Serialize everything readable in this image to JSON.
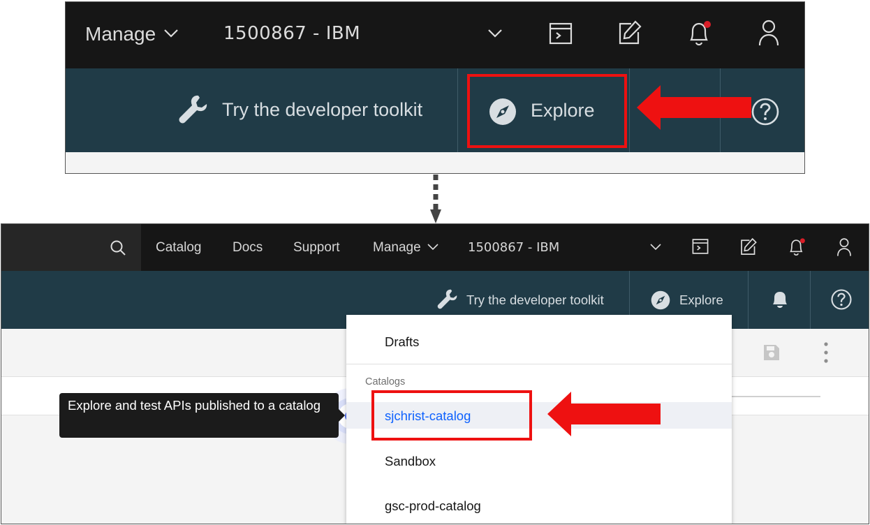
{
  "top_screenshot": {
    "header": {
      "manage_label": "Manage",
      "org_label": "1500867 - IBM"
    },
    "subheader": {
      "toolkit_label": "Try the developer toolkit",
      "explore_label": "Explore"
    }
  },
  "bottom_screenshot": {
    "header": {
      "nav_items": [
        "Catalog",
        "Docs",
        "Support"
      ],
      "manage_label": "Manage",
      "org_label": "1500867 - IBM"
    },
    "subheader": {
      "toolkit_label": "Try the developer toolkit",
      "explore_label": "Explore"
    },
    "dropdown": {
      "drafts_label": "Drafts",
      "section_header": "Catalogs",
      "items": [
        "sjchrist-catalog",
        "Sandbox",
        "gsc-prod-catalog"
      ],
      "selected_item": "sjchrist-catalog"
    },
    "tooltip_text": "Explore and test APIs published to a catalog"
  },
  "colors": {
    "header_bg": "#161616",
    "subheader_bg": "#203b47",
    "highlight_red": "#ee1111",
    "link_blue": "#0f62fe",
    "notification_dot": "#da1e28"
  },
  "icons": [
    "chevron-down-icon",
    "terminal-icon",
    "edit-icon",
    "bell-icon",
    "user-icon",
    "wrench-icon",
    "compass-icon",
    "help-icon",
    "search-icon",
    "save-icon",
    "overflow-menu-icon"
  ]
}
